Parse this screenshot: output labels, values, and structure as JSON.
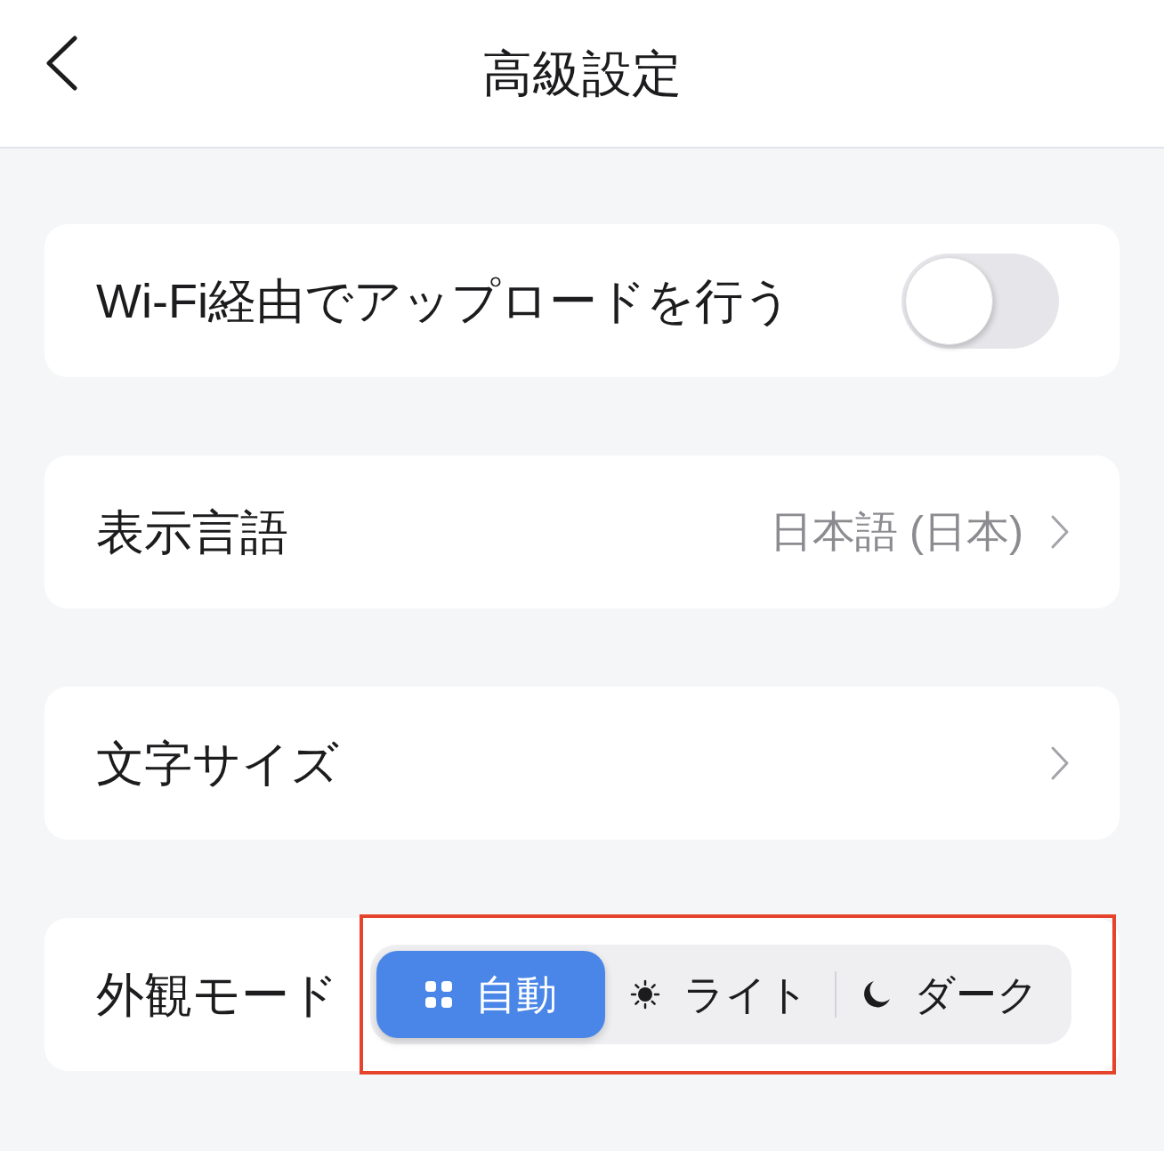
{
  "header": {
    "title": "高級設定"
  },
  "settings": [
    {
      "kind": "toggle",
      "label": "Wi-Fi経由でアップロードを行う",
      "on": false
    },
    {
      "kind": "link",
      "label": "表示言語",
      "value": "日本語 (日本)"
    },
    {
      "kind": "link",
      "label": "文字サイズ"
    },
    {
      "kind": "segmented",
      "label": "外観モード",
      "highlighted": true,
      "options": [
        {
          "label": "自動",
          "selected": true
        },
        {
          "label": "ライト",
          "selected": false
        },
        {
          "label": "ダーク",
          "selected": false
        }
      ]
    }
  ]
}
